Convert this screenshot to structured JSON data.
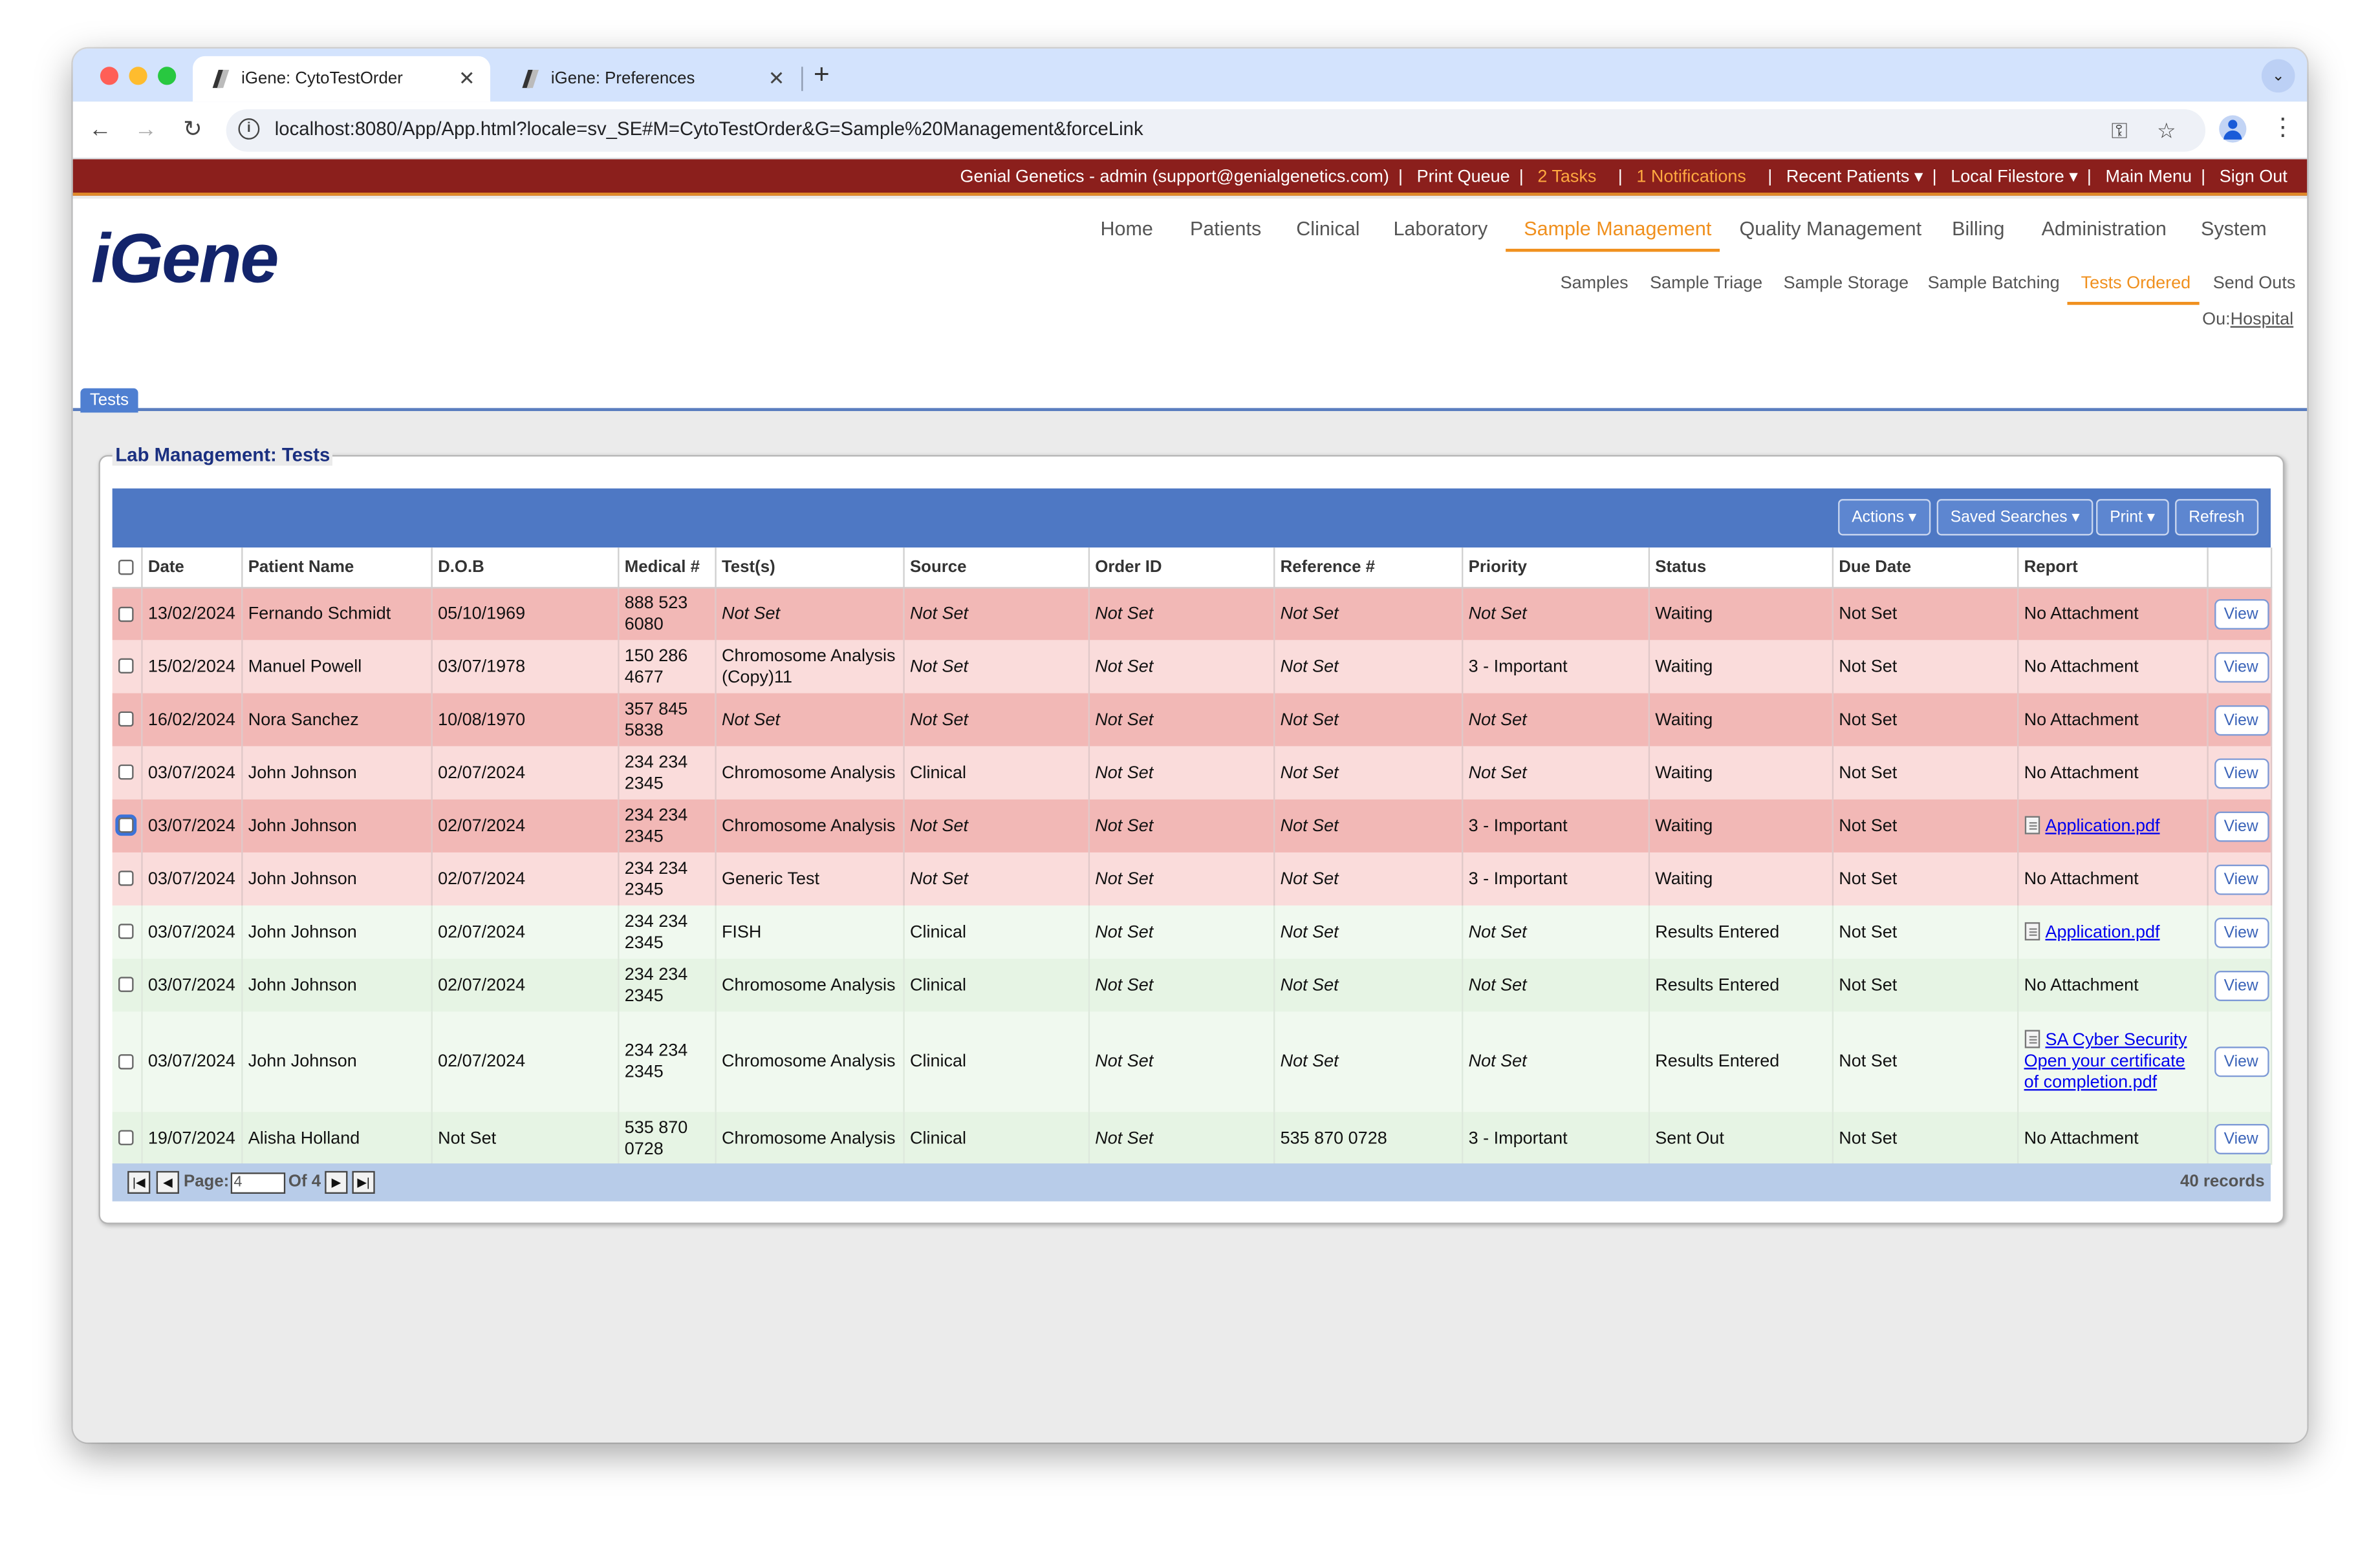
{
  "browser": {
    "tabs": [
      {
        "title": "iGene: CytoTestOrder",
        "close": "✕"
      },
      {
        "title": "iGene: Preferences",
        "close": "✕"
      }
    ],
    "new_tab": "+",
    "tab_menu": "⌄",
    "url": "localhost:8080/App/App.html?locale=sv_SE#M=CytoTestOrder&G=Sample%20Management&forceLink",
    "info_glyph": "i"
  },
  "topbar": {
    "org_user": "Genial Genetics - admin (support@genialgenetics.com)",
    "print_queue": "Print Queue",
    "tasks": "2 Tasks",
    "notifications": "1 Notifications",
    "recent_patients": "Recent Patients ▾",
    "local_filestore": "Local Filestore ▾",
    "main_menu": "Main Menu",
    "sign_out": "Sign Out",
    "sep": "|"
  },
  "header": {
    "logo": "iGene",
    "main_nav": [
      "Home",
      "Patients",
      "Clinical",
      "Laboratory",
      "Sample Management",
      "Quality Management",
      "Billing",
      "Administration",
      "System"
    ],
    "main_nav_active": "Sample Management",
    "sub_nav": [
      "Samples",
      "Sample Triage",
      "Sample Storage",
      "Sample Batching",
      "Tests Ordered",
      "Send Outs"
    ],
    "sub_nav_active": "Tests Ordered",
    "ou_label": "Ou:",
    "ou_value": "Hospital",
    "page_tab": "Tests"
  },
  "panel": {
    "title": "Lab Management: Tests",
    "buttons": {
      "actions": "Actions ▾",
      "saved_searches": "Saved Searches ▾",
      "print": "Print ▾",
      "refresh": "Refresh"
    },
    "columns": [
      "Date",
      "Patient Name",
      "D.O.B",
      "Medical #",
      "Test(s)",
      "Source",
      "Order ID",
      "Reference #",
      "Priority",
      "Status",
      "Due Date",
      "Report"
    ],
    "rows": [
      {
        "date": "13/02/2024",
        "patient": "Fernando Schmidt",
        "dob": "05/10/1969",
        "medical": "888 523 6080",
        "tests": "Not Set",
        "source": "Not Set",
        "order_id": "Not Set",
        "reference": "Not Set",
        "priority": "Not Set",
        "status": "Waiting",
        "due": "Not Set",
        "report": "No Attachment",
        "view": "View"
      },
      {
        "date": "15/02/2024",
        "patient": "Manuel Powell",
        "dob": "03/07/1978",
        "medical": "150 286 4677",
        "tests": "Chromosome Analysis (Copy)11",
        "source": "Not Set",
        "order_id": "Not Set",
        "reference": "Not Set",
        "priority": "3 - Important",
        "status": "Waiting",
        "due": "Not Set",
        "report": "No Attachment",
        "view": "View"
      },
      {
        "date": "16/02/2024",
        "patient": "Nora Sanchez",
        "dob": "10/08/1970",
        "medical": "357 845 5838",
        "tests": "Not Set",
        "source": "Not Set",
        "order_id": "Not Set",
        "reference": "Not Set",
        "priority": "Not Set",
        "status": "Waiting",
        "due": "Not Set",
        "report": "No Attachment",
        "view": "View"
      },
      {
        "date": "03/07/2024",
        "patient": "John Johnson",
        "dob": "02/07/2024",
        "medical": "234 234 2345",
        "tests": "Chromosome Analysis",
        "source": "Clinical",
        "order_id": "Not Set",
        "reference": "Not Set",
        "priority": "Not Set",
        "status": "Waiting",
        "due": "Not Set",
        "report": "No Attachment",
        "view": "View"
      },
      {
        "date": "03/07/2024",
        "patient": "John Johnson",
        "dob": "02/07/2024",
        "medical": "234 234 2345",
        "tests": "Chromosome Analysis",
        "source": "Not Set",
        "order_id": "Not Set",
        "reference": "Not Set",
        "priority": "3 - Important",
        "status": "Waiting",
        "due": "Not Set",
        "report": "Application.pdf",
        "view": "View"
      },
      {
        "date": "03/07/2024",
        "patient": "John Johnson",
        "dob": "02/07/2024",
        "medical": "234 234 2345",
        "tests": "Generic Test",
        "source": "Not Set",
        "order_id": "Not Set",
        "reference": "Not Set",
        "priority": "3 - Important",
        "status": "Waiting",
        "due": "Not Set",
        "report": "No Attachment",
        "view": "View"
      },
      {
        "date": "03/07/2024",
        "patient": "John Johnson",
        "dob": "02/07/2024",
        "medical": "234 234 2345",
        "tests": "FISH",
        "source": "Clinical",
        "order_id": "Not Set",
        "reference": "Not Set",
        "priority": "Not Set",
        "status": "Results Entered",
        "due": "Not Set",
        "report": "Application.pdf",
        "view": "View"
      },
      {
        "date": "03/07/2024",
        "patient": "John Johnson",
        "dob": "02/07/2024",
        "medical": "234 234 2345",
        "tests": "Chromosome Analysis",
        "source": "Clinical",
        "order_id": "Not Set",
        "reference": "Not Set",
        "priority": "Not Set",
        "status": "Results Entered",
        "due": "Not Set",
        "report": "No Attachment",
        "view": "View"
      },
      {
        "date": "03/07/2024",
        "patient": "John Johnson",
        "dob": "02/07/2024",
        "medical": "234 234 2345",
        "tests": "Chromosome Analysis",
        "source": "Clinical",
        "order_id": "Not Set",
        "reference": "Not Set",
        "priority": "Not Set",
        "status": "Results Entered",
        "due": "Not Set",
        "report": "SA Cyber Security  Open your certificate of completion.pdf",
        "view": "View"
      },
      {
        "date": "19/07/2024",
        "patient": "Alisha Holland",
        "dob": "Not Set",
        "medical": "535 870 0728",
        "tests": "Chromosome Analysis",
        "source": "Clinical",
        "order_id": "Not Set",
        "reference": "535 870 0728",
        "priority": "3 - Important",
        "status": "Sent Out",
        "due": "Not Set",
        "report": "No Attachment",
        "view": "View"
      }
    ],
    "pager": {
      "page_label": "Page:",
      "page_value": "4",
      "of_label": "Of 4",
      "records": "40 records"
    }
  },
  "colors": {
    "topbar": "#8b1f1c",
    "accent": "#f0901e",
    "toolbar": "#4e78c4",
    "waiting_row": "#f2b8b6",
    "results_row": "#f0f9ef",
    "logo": "#13246b"
  }
}
